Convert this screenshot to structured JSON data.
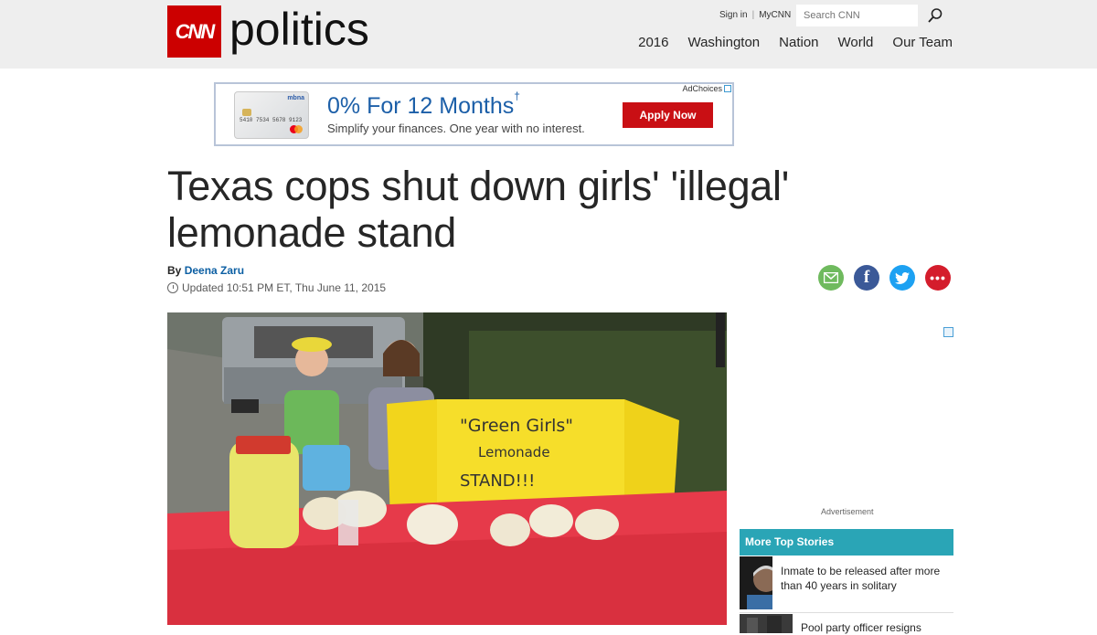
{
  "header": {
    "logo_text": "CNN",
    "section_word": "politics",
    "sign_in": "Sign in",
    "my_cnn": "MyCNN",
    "search_placeholder": "Search CNN",
    "nav": [
      "2016",
      "Washington",
      "Nation",
      "World",
      "Our Team"
    ]
  },
  "ad": {
    "card_brand": "mbna",
    "card_number": "5410 7534 5678 9123",
    "headline": "0% For 12 Months",
    "dagger": "†",
    "subtext": "Simplify your finances. One year with no interest.",
    "cta": "Apply Now",
    "adchoices": "AdChoices"
  },
  "article": {
    "headline": "Texas cops shut down girls' 'illegal' lemonade stand",
    "by_prefix": "By",
    "author": "Deena Zaru",
    "updated": "Updated 10:51 PM ET, Thu June 11, 2015",
    "photo_sign_title": "\"Green Girls\"",
    "photo_sign_line2": "Lemonade",
    "photo_sign_line3": "STAND!!!"
  },
  "share": [
    {
      "name": "email",
      "color": "#6fba5e"
    },
    {
      "name": "facebook",
      "color": "#3b5998"
    },
    {
      "name": "twitter",
      "color": "#1da1f2"
    },
    {
      "name": "more",
      "color": "#d41d2c"
    }
  ],
  "rail": {
    "advertisement": "Advertisement",
    "more_top": "More Top Stories",
    "stories": [
      "Inmate to be released after more than 40 years in solitary",
      "Pool party officer resigns"
    ]
  }
}
